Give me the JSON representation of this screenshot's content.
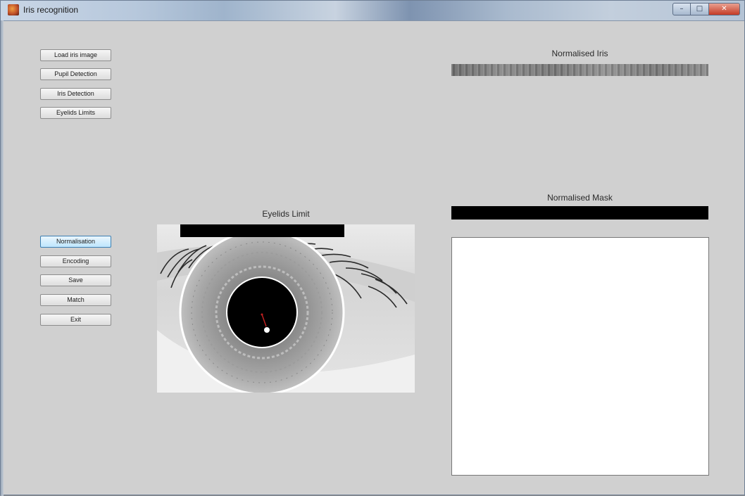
{
  "window": {
    "title": "Iris recognition",
    "controls": {
      "minimize": "–",
      "maximize": "□",
      "close": "✕"
    }
  },
  "buttons": {
    "load": "Load iris image",
    "pupil": "Pupil Detection",
    "iris": "Iris Detection",
    "eyelids": "Eyelids Limits",
    "normalisation": "Normalisation",
    "encoding": "Encoding",
    "save": "Save",
    "match": "Match",
    "exit": "Exit"
  },
  "panels": {
    "eyelids_title": "Eyelids Limit",
    "normalised_iris_title": "Normalised Iris",
    "normalised_mask_title": "Normalised Mask"
  },
  "icons": {
    "app": "matlab-figure-icon",
    "minimize": "minimize-icon",
    "maximize": "maximize-icon",
    "close": "close-icon"
  }
}
